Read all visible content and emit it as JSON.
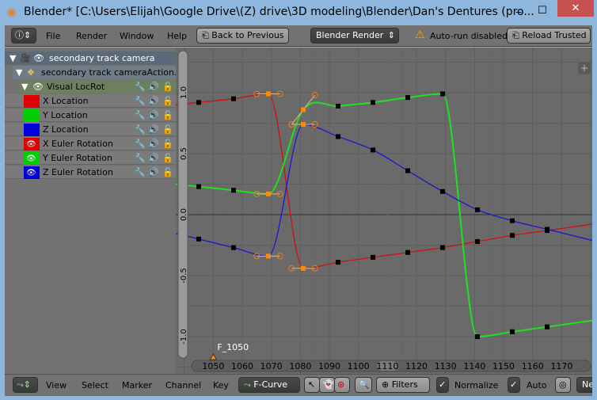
{
  "window": {
    "title": "Blender* [C:\\Users\\Elijah\\Google Drive\\(Z) drive\\3D modeling\\Blender\\Dan's Dentures (pro...",
    "minimize": "‒",
    "maximize": "☐",
    "close": "✕"
  },
  "topbar": {
    "editor_icon": "info-icon",
    "menus": [
      "File",
      "Render",
      "Window",
      "Help"
    ],
    "back_button": "Back to Previous",
    "render_engine": "Blender Render",
    "warning": "Auto-run disabled",
    "reload_button": "Reload Trusted"
  },
  "channels": [
    {
      "label": "secondary track camera",
      "icon": "camera-icon"
    },
    {
      "label": "secondary track cameraAction.00",
      "icon": "action-icon"
    },
    {
      "label": "Visual LocRot",
      "icon": "group-icon"
    },
    {
      "label": "X Location",
      "color": "#e00000",
      "visible": false
    },
    {
      "label": "Y Location",
      "color": "#00d000",
      "visible": false
    },
    {
      "label": "Z Location",
      "color": "#0000d8",
      "visible": false
    },
    {
      "label": "X Euler Rotation",
      "color": "#e00000",
      "visible": true
    },
    {
      "label": "Y Euler Rotation",
      "color": "#00d000",
      "visible": true
    },
    {
      "label": "Z Euler Rotation",
      "color": "#0000d8",
      "visible": true
    }
  ],
  "marker": {
    "label": "F_1050",
    "frame": 1050
  },
  "bottombar": {
    "editor_icon": "graph-editor-icon",
    "menus": [
      "View",
      "Select",
      "Marker",
      "Channel",
      "Key"
    ],
    "mode": "F-Curve",
    "filters": "Filters",
    "normalize": "Normalize",
    "normalize_checked": true,
    "auto": "Auto",
    "auto_checked": true,
    "new": "Ne"
  },
  "chart_data": {
    "type": "line",
    "current_frame": 1110,
    "xlim": [
      1042,
      1185
    ],
    "ylim": [
      -1.1,
      1.35
    ],
    "x_ticks": [
      "1050",
      "1060",
      "1070",
      "1080",
      "1090",
      "1100",
      "1110",
      "1120",
      "1130",
      "1140",
      "1150",
      "1160",
      "1170"
    ],
    "y_ticks": [
      "1.0",
      "0.5",
      "0.0",
      "-0.5",
      "-1.0"
    ],
    "grid": true,
    "x": [
      1045,
      1057,
      1069,
      1081,
      1093,
      1105,
      1117,
      1129,
      1141,
      1153,
      1165
    ],
    "series": [
      {
        "color": "#d01010",
        "values": [
          0.92,
          0.95,
          0.99,
          -0.44,
          -0.39,
          -0.35,
          -0.31,
          -0.27,
          -0.22,
          -0.17,
          -0.13
        ],
        "selected_index": 2
      },
      {
        "color": "#20e020",
        "values": [
          0.23,
          0.2,
          0.17,
          0.86,
          0.89,
          0.92,
          0.96,
          0.99,
          -1.0,
          -0.96,
          -0.92
        ],
        "selected_index": 3
      },
      {
        "color": "#1818d0",
        "values": [
          -0.2,
          -0.27,
          -0.34,
          0.74,
          0.64,
          0.53,
          0.36,
          0.19,
          0.04,
          -0.05,
          -0.12
        ],
        "selected_index": 3
      }
    ],
    "selected_keys": [
      {
        "series": 0,
        "index": 2
      },
      {
        "series": 0,
        "index": 3
      },
      {
        "series": 1,
        "index": 2
      },
      {
        "series": 1,
        "index": 3
      },
      {
        "series": 2,
        "index": 2
      },
      {
        "series": 2,
        "index": 3
      }
    ]
  }
}
